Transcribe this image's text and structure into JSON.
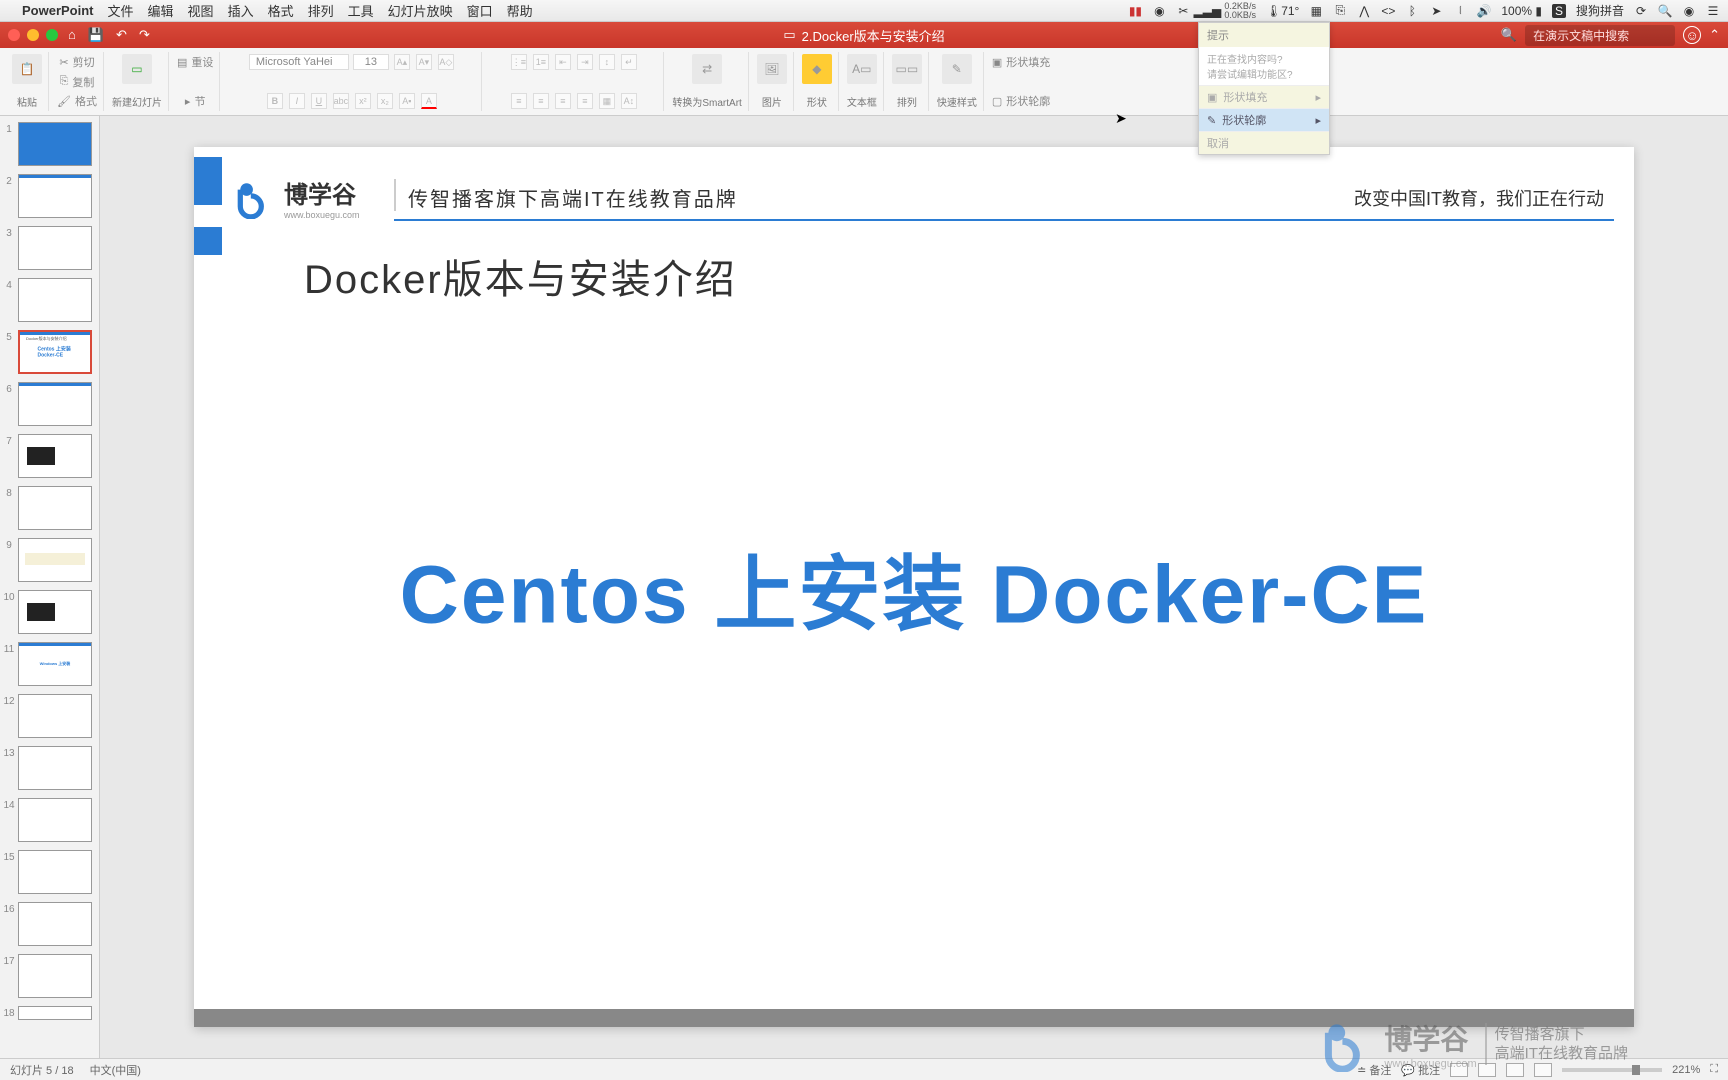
{
  "menubar": {
    "app": "PowerPoint",
    "menus": [
      "文件",
      "编辑",
      "视图",
      "插入",
      "格式",
      "排列",
      "工具",
      "幻灯片放映",
      "窗口",
      "帮助"
    ],
    "right": {
      "net_up": "0.2KB/s",
      "net_down": "0.0KB/s",
      "temp": "71°",
      "battery": "100%",
      "ime": "搜狗拼音"
    }
  },
  "titlebar": {
    "doc_title": "2.Docker版本与安装介绍",
    "search_placeholder": "在演示文稿中搜索"
  },
  "ribbon": {
    "paste": "粘贴",
    "cut": "剪切",
    "copy": "复制",
    "format": "格式",
    "new_slide": "新建幻灯片",
    "reset": "重设",
    "section": "节",
    "font_name": "Microsoft YaHei",
    "font_size": "13",
    "convert_smartart": "转换为SmartArt",
    "picture": "图片",
    "shape": "形状",
    "textbox": "文本框",
    "arrange": "排列",
    "quick_styles": "快速样式",
    "shape_fill": "形状填充",
    "shape_outline": "形状轮廓"
  },
  "tooltip": {
    "head": "提示",
    "line1": "正在查找内容吗?",
    "line2": "请尝试编辑功能区?",
    "opt_fill": "形状填充",
    "opt_outline": "形状轮廓",
    "cancel": "取消"
  },
  "thumbs": {
    "count": 18,
    "selected": 5
  },
  "slide": {
    "brand_cn": "博学谷",
    "brand_en": "www.boxuegu.com",
    "tagline_l": "传智播客旗下高端IT在线教育品牌",
    "tagline_r": "改变中国IT教育，我们正在行动",
    "title": "Docker版本与安装介绍",
    "main": "Centos 上安装 Docker-CE"
  },
  "watermark": {
    "cn": "博学谷",
    "en": "www.boxuegu.com",
    "r1": "传智播客旗下",
    "r2": "高端IT在线教育品牌"
  },
  "status": {
    "slide_info": "幻灯片 5 / 18",
    "lang": "中文(中国)",
    "notes": "备注",
    "comments": "批注",
    "zoom": "221%"
  }
}
